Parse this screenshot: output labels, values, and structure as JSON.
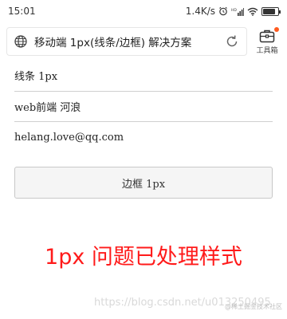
{
  "status_bar": {
    "time": "15:01",
    "network_speed": "1.4K/s",
    "battery_percent": 85
  },
  "browser": {
    "title": "移动端 1px(线条/边框) 解决方案",
    "toolbox_label": "工具箱"
  },
  "list": {
    "items": [
      "线条 1px",
      "web前端 河浪",
      "helang.love@qq.com"
    ]
  },
  "border_button": {
    "label": "边框 1px"
  },
  "caption": "1px 问题已处理样式",
  "watermark": {
    "url": "https://blog.csdn.net/u013250495",
    "credit": "@稀土掘金技术社区"
  },
  "colors": {
    "caption": "#ff1a1a",
    "badge": "#ff5a1f",
    "divider": "#cfcfcf"
  }
}
